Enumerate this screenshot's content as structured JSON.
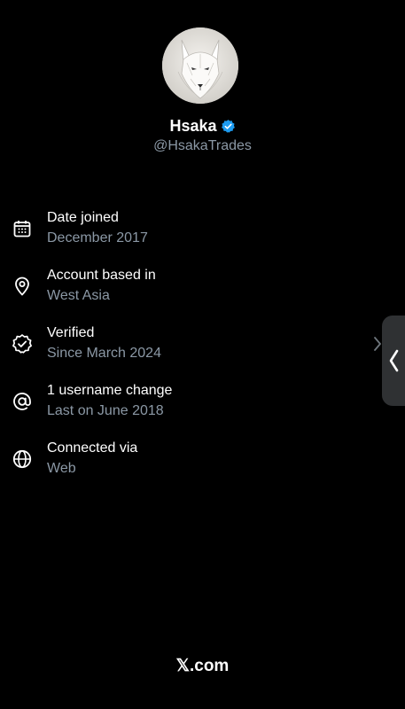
{
  "profile": {
    "display_name": "Hsaka",
    "handle": "@HsakaTrades",
    "verified": true
  },
  "info": [
    {
      "icon": "calendar-icon",
      "title": "Date joined",
      "value": "December 2017"
    },
    {
      "icon": "location-pin-icon",
      "title": "Account based in",
      "value": "West Asia"
    },
    {
      "icon": "verified-check-icon",
      "title": "Verified",
      "value": "Since March 2024"
    },
    {
      "icon": "at-sign-icon",
      "title": "1 username change",
      "value": "Last on June 2018"
    },
    {
      "icon": "globe-icon",
      "title": "Connected via",
      "value": "Web"
    }
  ],
  "footer": {
    "brand": "𝕏.com"
  },
  "colors": {
    "background": "#000000",
    "primary_text": "#ffffff",
    "secondary_text": "#8b98a5",
    "verified_badge": "#1d9bf0",
    "side_handle": "#2f3133"
  }
}
